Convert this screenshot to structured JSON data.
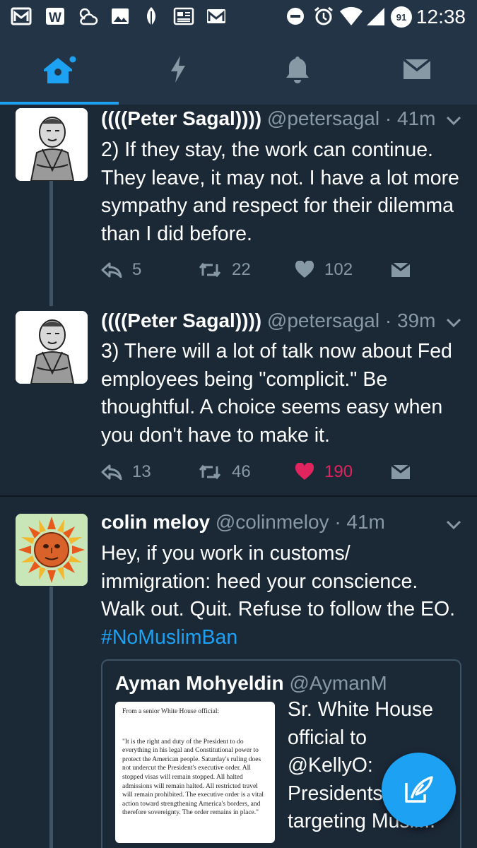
{
  "status_bar": {
    "time": "12:38",
    "battery_level": "91"
  },
  "nav": {
    "tabs": [
      "home",
      "moments",
      "notifications",
      "messages"
    ],
    "active": "home"
  },
  "tweets": [
    {
      "name": "((((Peter Sagal))))",
      "handle": "@petersagal",
      "time": "· 41m",
      "text": "2) If they stay, the work can continue. They leave, it may not. I have a lot more sympathy and respect for their dilemma than I did before.",
      "replies": "5",
      "retweets": "22",
      "likes": "102",
      "liked": false
    },
    {
      "name": "((((Peter Sagal))))",
      "handle": "@petersagal",
      "time": "· 39m",
      "text": "3) There will a lot of talk now about Fed employees being \"complicit.\" Be thoughtful. A choice seems easy when you don't have to make it.",
      "replies": "13",
      "retweets": "46",
      "likes": "190",
      "liked": true
    },
    {
      "name": "colin meloy",
      "handle": "@colinmeloy",
      "time": "· 41m",
      "text": "Hey, if you work in customs/ immigration: heed your conscience. Walk out. Quit. Refuse to follow the EO.",
      "hashtag": "#NoMuslimBan",
      "quote": {
        "name": "Ayman Mohyeldin",
        "handle": "@AymanM",
        "text": "Sr. White House official to @KellyO: Presidents targeting Musli...",
        "image_header": "From a senior White House official:",
        "image_text": "\"It is the right and duty of the President to do everything in his legal and Constitutional power to protect the American people. Saturday's ruling does not undercut the President's executive order. All stopped visas will remain stopped.  All halted admissions will remain halted.  All restricted travel will remain prohibited.  The executive order is a vital action toward strengthening America's borders, and therefore sovereignty. The order remains in place.\""
      }
    }
  ],
  "colors": {
    "background": "#1b2836",
    "bar": "#243447",
    "accent": "#1da1f2",
    "like": "#e0245e",
    "muted": "#8899a6"
  }
}
